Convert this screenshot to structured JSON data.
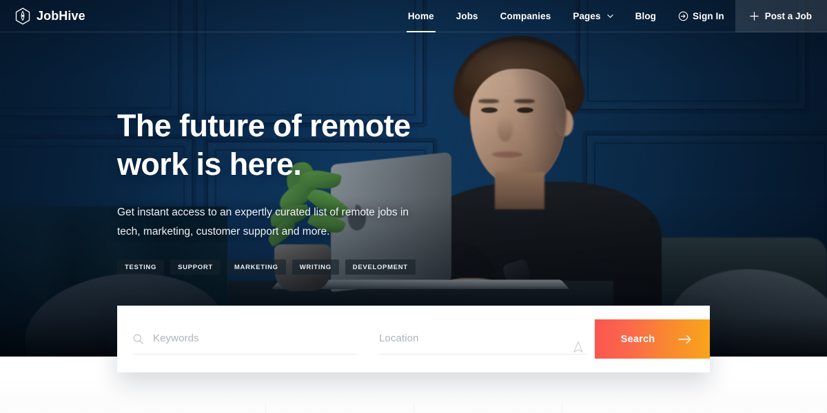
{
  "brand": {
    "name": "JobHive",
    "logo_icon": "hexagon-logo-icon",
    "logo_color": "#ffffff"
  },
  "nav": {
    "items": [
      {
        "label": "Home",
        "active": true,
        "icon": null
      },
      {
        "label": "Jobs",
        "active": false,
        "icon": null
      },
      {
        "label": "Companies",
        "active": false,
        "icon": null
      },
      {
        "label": "Pages",
        "active": false,
        "icon": "chevron-down-icon"
      },
      {
        "label": "Blog",
        "active": false,
        "icon": null
      },
      {
        "label": "Sign In",
        "active": false,
        "icon": "sign-in-circle-arrow-icon"
      }
    ],
    "post_job": {
      "label": "Post a Job",
      "icon": "plus-icon"
    }
  },
  "hero": {
    "headline_line1": "The future of remote",
    "headline_line2": "work is here.",
    "subhead_line1": "Get instant access to an expertly curated list of remote jobs in",
    "subhead_line2": "tech, marketing, customer support and more.",
    "tags": [
      "TESTING",
      "SUPPORT",
      "MARKETING",
      "WRITING",
      "DEVELOPMENT"
    ],
    "background_description": "man working on laptop against navy paneled wall",
    "overlay_color": "#0d2f52"
  },
  "search": {
    "keywords": {
      "placeholder": "Keywords",
      "value": "",
      "icon": "search-icon"
    },
    "location": {
      "placeholder": "Location",
      "value": "",
      "icon": "navigation-arrow-icon"
    },
    "button": {
      "label": "Search",
      "icon": "arrow-right-icon",
      "gradient_from": "#fa564f",
      "gradient_to": "#f9a41b"
    }
  }
}
